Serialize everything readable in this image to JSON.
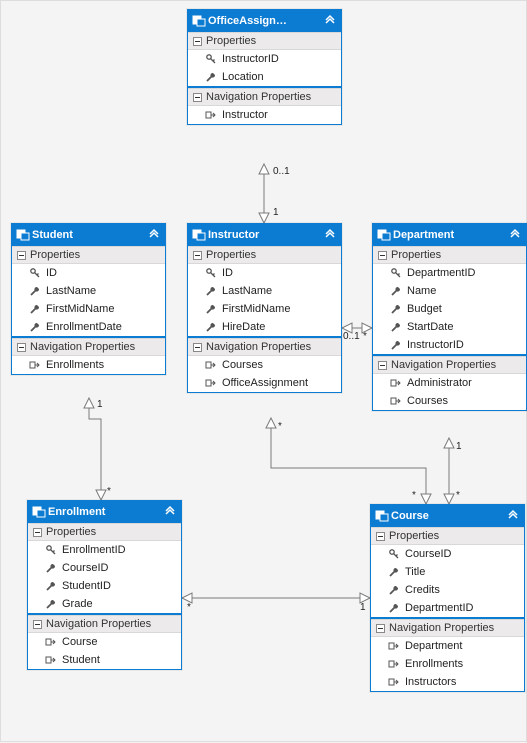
{
  "section_labels": {
    "properties": "Properties",
    "navprops": "Navigation Properties"
  },
  "cardinalities": {
    "oa_inst_top": "0..1",
    "oa_inst_bottom": "1",
    "inst_dept_left": "0..1",
    "inst_dept_right": "*",
    "stu_enr_top": "1",
    "stu_enr_bottom": "*",
    "inst_course_top": "*",
    "inst_course_bottom": "*",
    "dept_course_top": "1",
    "dept_course_bottom": "*",
    "enr_course_left": "*",
    "enr_course_right": "1"
  },
  "entities": {
    "office": {
      "title": "OfficeAssign…",
      "props": [
        "InstructorID",
        "Location"
      ],
      "prop_icons": [
        "key",
        "wrench"
      ],
      "navs": [
        "Instructor"
      ]
    },
    "student": {
      "title": "Student",
      "props": [
        "ID",
        "LastName",
        "FirstMidName",
        "EnrollmentDate"
      ],
      "prop_icons": [
        "key",
        "wrench",
        "wrench",
        "wrench"
      ],
      "navs": [
        "Enrollments"
      ]
    },
    "instructor": {
      "title": "Instructor",
      "props": [
        "ID",
        "LastName",
        "FirstMidName",
        "HireDate"
      ],
      "prop_icons": [
        "key",
        "wrench",
        "wrench",
        "wrench"
      ],
      "navs": [
        "Courses",
        "OfficeAssignment"
      ]
    },
    "department": {
      "title": "Department",
      "props": [
        "DepartmentID",
        "Name",
        "Budget",
        "StartDate",
        "InstructorID"
      ],
      "prop_icons": [
        "key",
        "wrench",
        "wrench",
        "wrench",
        "wrench"
      ],
      "navs": [
        "Administrator",
        "Courses"
      ]
    },
    "enrollment": {
      "title": "Enrollment",
      "props": [
        "EnrollmentID",
        "CourseID",
        "StudentID",
        "Grade"
      ],
      "prop_icons": [
        "key",
        "wrench",
        "wrench",
        "wrench"
      ],
      "navs": [
        "Course",
        "Student"
      ]
    },
    "course": {
      "title": "Course",
      "props": [
        "CourseID",
        "Title",
        "Credits",
        "DepartmentID"
      ],
      "prop_icons": [
        "key",
        "wrench",
        "wrench",
        "wrench"
      ],
      "navs": [
        "Department",
        "Enrollments",
        "Instructors"
      ]
    }
  },
  "chart_data": {
    "type": "diagram",
    "title": "Entity Data Model",
    "entities": [
      {
        "name": "OfficeAssignment",
        "properties": [
          {
            "name": "InstructorID",
            "key": true
          },
          {
            "name": "Location"
          }
        ],
        "navigation": [
          "Instructor"
        ]
      },
      {
        "name": "Student",
        "properties": [
          {
            "name": "ID",
            "key": true
          },
          {
            "name": "LastName"
          },
          {
            "name": "FirstMidName"
          },
          {
            "name": "EnrollmentDate"
          }
        ],
        "navigation": [
          "Enrollments"
        ]
      },
      {
        "name": "Instructor",
        "properties": [
          {
            "name": "ID",
            "key": true
          },
          {
            "name": "LastName"
          },
          {
            "name": "FirstMidName"
          },
          {
            "name": "HireDate"
          }
        ],
        "navigation": [
          "Courses",
          "OfficeAssignment"
        ]
      },
      {
        "name": "Department",
        "properties": [
          {
            "name": "DepartmentID",
            "key": true
          },
          {
            "name": "Name"
          },
          {
            "name": "Budget"
          },
          {
            "name": "StartDate"
          },
          {
            "name": "InstructorID"
          }
        ],
        "navigation": [
          "Administrator",
          "Courses"
        ]
      },
      {
        "name": "Enrollment",
        "properties": [
          {
            "name": "EnrollmentID",
            "key": true
          },
          {
            "name": "CourseID"
          },
          {
            "name": "StudentID"
          },
          {
            "name": "Grade"
          }
        ],
        "navigation": [
          "Course",
          "Student"
        ]
      },
      {
        "name": "Course",
        "properties": [
          {
            "name": "CourseID",
            "key": true
          },
          {
            "name": "Title"
          },
          {
            "name": "Credits"
          },
          {
            "name": "DepartmentID"
          }
        ],
        "navigation": [
          "Department",
          "Enrollments",
          "Instructors"
        ]
      }
    ],
    "relationships": [
      {
        "from": "OfficeAssignment",
        "to": "Instructor",
        "from_mult": "0..1",
        "to_mult": "1"
      },
      {
        "from": "Instructor",
        "to": "Department",
        "from_mult": "0..1",
        "to_mult": "*"
      },
      {
        "from": "Student",
        "to": "Enrollment",
        "from_mult": "1",
        "to_mult": "*"
      },
      {
        "from": "Instructor",
        "to": "Course",
        "from_mult": "*",
        "to_mult": "*"
      },
      {
        "from": "Department",
        "to": "Course",
        "from_mult": "1",
        "to_mult": "*"
      },
      {
        "from": "Enrollment",
        "to": "Course",
        "from_mult": "*",
        "to_mult": "1"
      }
    ]
  }
}
